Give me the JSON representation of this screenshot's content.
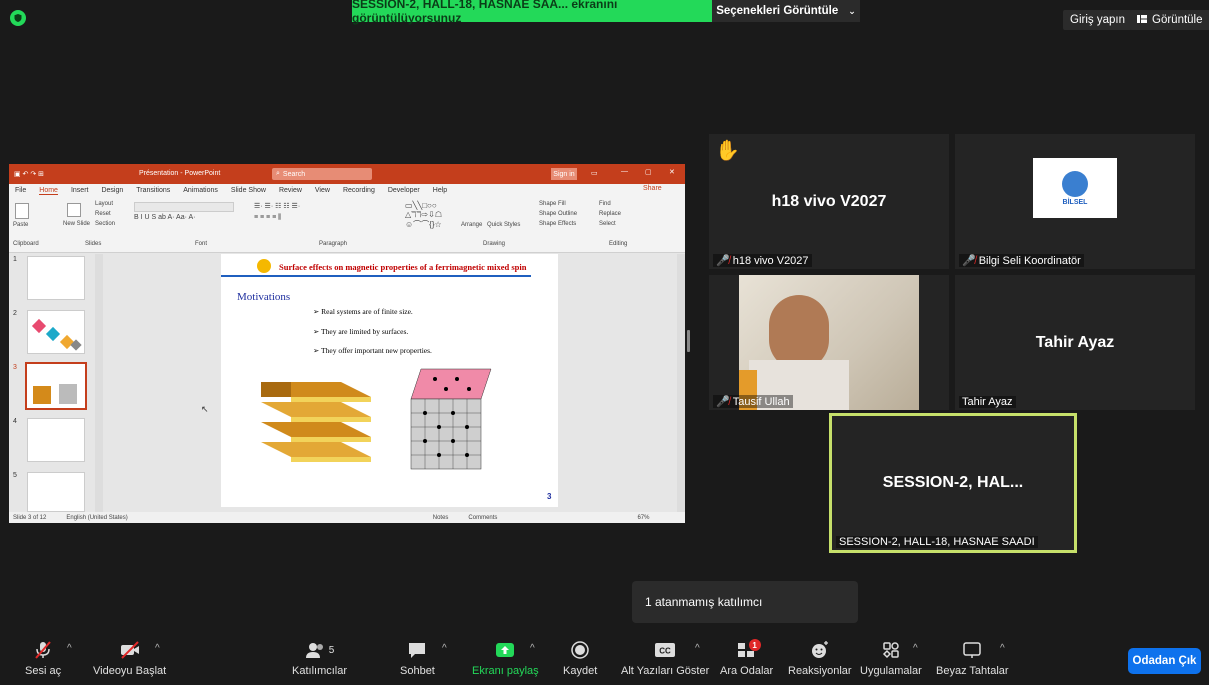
{
  "top": {
    "share_banner": "SESSION-2, HALL-18, HASNAE SAA... ekranını görüntülüyorsunuz",
    "view_options": "Seçenekleri Görüntüle",
    "sign_in": "Giriş yapın",
    "view": "Görüntüle"
  },
  "ppt": {
    "title": "Présentation - PowerPoint",
    "search": "Search",
    "signin": "Sign in",
    "menu": [
      "File",
      "Home",
      "Insert",
      "Design",
      "Transitions",
      "Animations",
      "Slide Show",
      "Review",
      "View",
      "Recording",
      "Developer",
      "Help"
    ],
    "share": "Share",
    "ribbon_groups": [
      "Clipboard",
      "Slides",
      "Font",
      "Paragraph",
      "Drawing",
      "Editing"
    ],
    "ribbon_labels": {
      "paste": "Paste",
      "new_slide": "New Slide",
      "layout": "Layout",
      "reset": "Reset",
      "section": "Section",
      "arrange": "Arrange",
      "quick_styles": "Quick Styles",
      "shape_fill": "Shape Fill",
      "shape_outline": "Shape Outline",
      "shape_effects": "Shape Effects",
      "find": "Find",
      "replace": "Replace",
      "select": "Select"
    },
    "thumb_numbers": [
      "1",
      "2",
      "3",
      "4",
      "5"
    ],
    "slide": {
      "title": "Surface effects on magnetic properties of a ferrimagnetic mixed spin",
      "heading": "Motivations",
      "bullets": [
        "Real systems are of finite size.",
        "They are limited by surfaces.",
        "They offer important new properties."
      ],
      "page_number": "3"
    },
    "status": {
      "slide_of": "Slide 3 of 12",
      "language": "English (United States)",
      "notes": "Notes",
      "comments": "Comments",
      "zoom": "67%"
    }
  },
  "tiles": [
    {
      "name": "h18 vivo V2027",
      "center": "h18 vivo V2027",
      "muted": true,
      "hand": true
    },
    {
      "name": "Bilgi Seli Koordinatör",
      "center": "",
      "muted": true,
      "logo": "BİLSEL"
    },
    {
      "name": "Tausif Ullah",
      "center": "",
      "muted": true,
      "video": true
    },
    {
      "name": "Tahir Ayaz",
      "center": "Tahir Ayaz",
      "muted": false
    },
    {
      "name": "SESSION-2, HALL-18, HASNAE SAADI",
      "center": "SESSION-2,  HAL...",
      "muted": false,
      "active": true
    }
  ],
  "popup": "1 atanmamış katılımcı",
  "toolbar": {
    "unmute": "Sesi aç",
    "start_video": "Videoyu Başlat",
    "participants": "Katılımcılar",
    "participants_count": "5",
    "chat": "Sohbet",
    "share_screen": "Ekranı paylaş",
    "record": "Kaydet",
    "captions": "Alt Yazıları Göster",
    "breakout": "Ara Odalar",
    "breakout_badge": "1",
    "reactions": "Reaksiyonlar",
    "apps": "Uygulamalar",
    "whiteboards": "Beyaz Tahtalar",
    "leave": "Odadan Çık"
  },
  "colors": {
    "accent_green": "#23d959",
    "leave_blue": "#0e72ed",
    "ppt_red": "#c43e1c",
    "active_border": "#c6e06a"
  }
}
